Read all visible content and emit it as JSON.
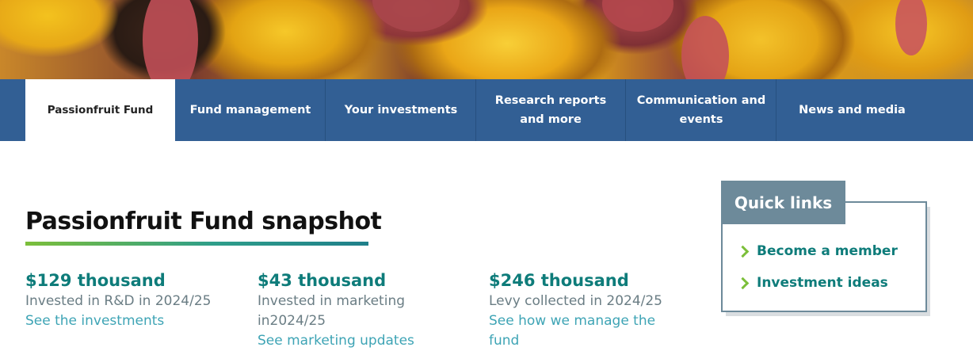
{
  "nav": {
    "items": [
      {
        "label": "Passionfruit Fund",
        "active": true
      },
      {
        "label": "Fund management",
        "active": false
      },
      {
        "label": "Your investments",
        "active": false
      },
      {
        "label": "Research reports and more",
        "active": false
      },
      {
        "label": "Communication and events",
        "active": false
      },
      {
        "label": "News and media",
        "active": false
      }
    ]
  },
  "snapshot": {
    "title": "Passionfruit Fund snapshot",
    "stats": [
      {
        "value": "$129 thousand",
        "description": "Invested in R&D in 2024/25",
        "link": "See the investments"
      },
      {
        "value": "$43 thousand",
        "description": "Invested in marketing in2024/25",
        "link": "See marketing updates"
      },
      {
        "value": "$246 thousand",
        "description": "Levy collected in 2024/25",
        "link": "See how we manage the fund"
      }
    ]
  },
  "quick_links": {
    "title": "Quick links",
    "items": [
      {
        "label": "Become a member"
      },
      {
        "label": "Investment ideas"
      }
    ]
  },
  "colors": {
    "nav_bg": "#325f94",
    "accent_teal": "#0e7c7a",
    "link_blue": "#3ea4b5",
    "chevron_green": "#7cbf3a",
    "quick_links_header": "#6d8a9a"
  }
}
